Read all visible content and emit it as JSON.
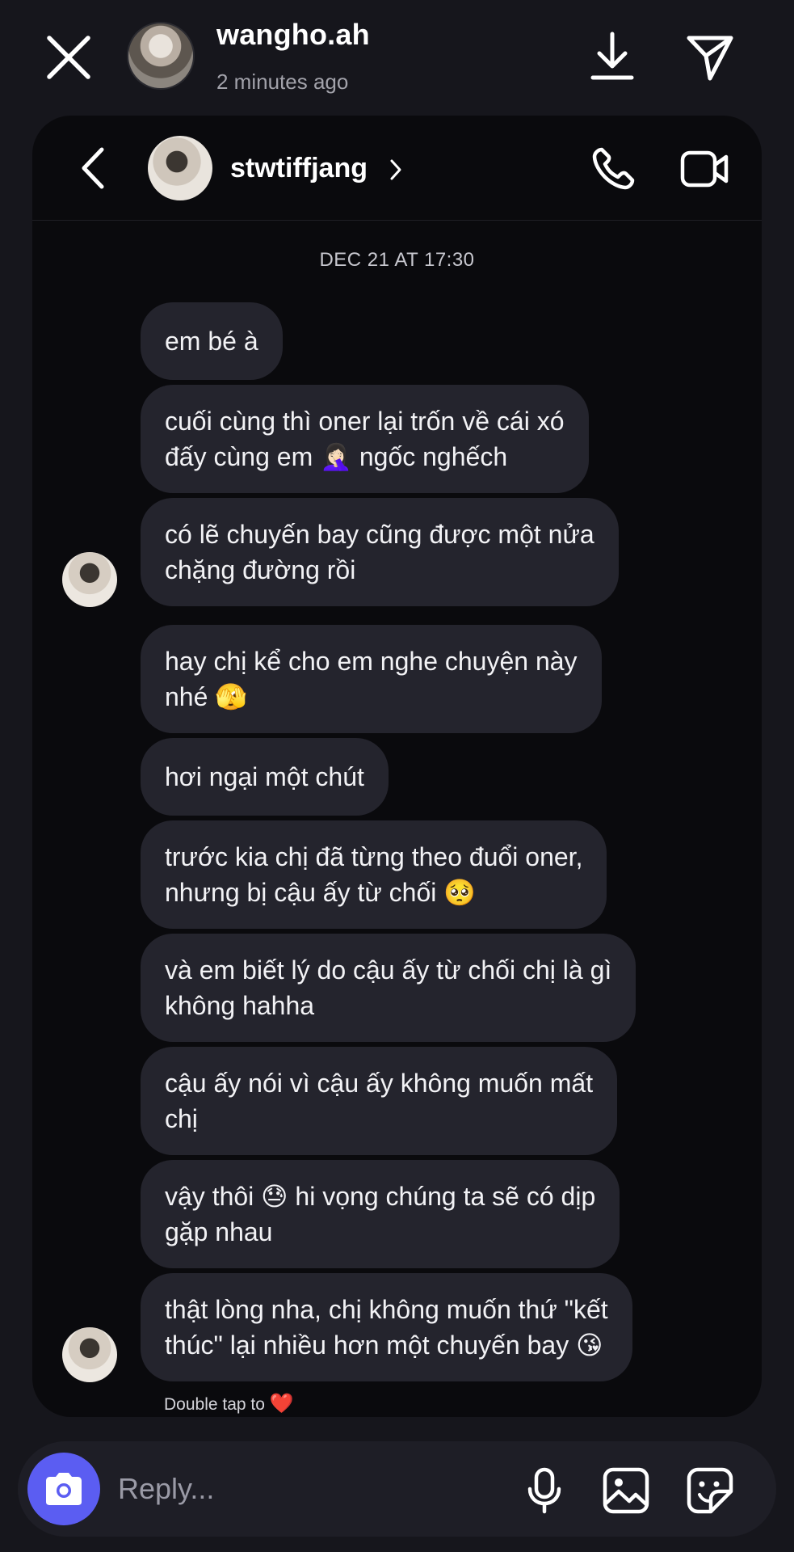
{
  "story": {
    "username": "wangho.ah",
    "time": "2 minutes ago"
  },
  "dm": {
    "username": "stwtiffjang",
    "date_separator": "DEC 21 AT 17:30",
    "messages": [
      "em bé à",
      "cuối cùng thì oner lại trốn về cái xó\nđấy cùng em 🤦🏻‍♀️ ngốc nghếch",
      "có lẽ chuyến bay cũng được một nửa\nchặng đường rồi",
      "hay chị kể cho em nghe chuyện này\nnhé 🫣",
      "hơi ngại một chút",
      "trước kia chị đã từng theo đuổi oner,\nnhưng bị cậu ấy từ chối 🥺",
      "và em biết lý do cậu ấy từ chối chị là gì\nkhông hahha",
      "cậu ấy nói vì cậu ấy không muốn mất\nchị",
      "vậy thôi 😓 hi vọng chúng ta sẽ có dịp\ngặp nhau",
      "thật lòng nha, chị không muốn thứ \"kết\nthúc\" lại nhiều hơn một chuyến bay 😘"
    ],
    "double_tap_text": "Double tap to",
    "double_tap_heart": "❤️"
  },
  "reply": {
    "placeholder": "Reply..."
  },
  "colors": {
    "background": "#16161c",
    "card": "#0a0a0d",
    "bubble": "#24242d",
    "camera_accent": "#5b5df2",
    "heart": "#ff3040"
  },
  "icons": [
    "close-icon",
    "download-icon",
    "send-icon",
    "back-icon",
    "chevron-right-icon",
    "phone-icon",
    "video-icon",
    "camera-icon",
    "microphone-icon",
    "gallery-icon",
    "sticker-icon"
  ]
}
